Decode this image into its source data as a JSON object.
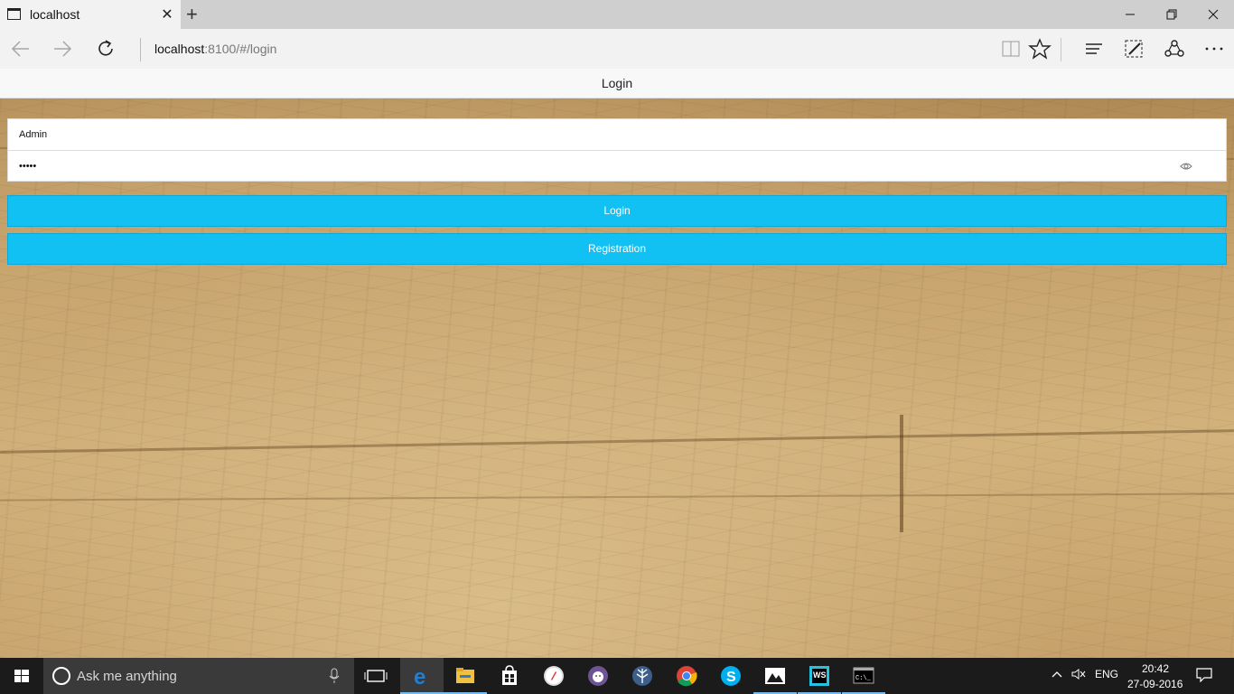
{
  "browser": {
    "tab_title": "localhost",
    "address_host": "localhost",
    "address_rest": ":8100/#/login"
  },
  "app": {
    "header_title": "Login",
    "username_value": "Admin",
    "password_value": "•••••",
    "login_button": "Login",
    "registration_button": "Registration"
  },
  "taskbar": {
    "search_placeholder": "Ask me anything",
    "language": "ENG",
    "time": "20:42",
    "date": "27-09-2016"
  },
  "colors": {
    "accent_button": "#11c1f3",
    "taskbar": "#1b1b1b",
    "edge_blue": "#1e7fd6"
  },
  "icons": [
    "tab-page-icon",
    "close-tab-icon",
    "new-tab-icon",
    "minimize-icon",
    "restore-icon",
    "close-window-icon",
    "back-icon",
    "forward-icon",
    "refresh-icon",
    "reading-view-icon",
    "favorite-star-icon",
    "hub-icon",
    "web-note-icon",
    "share-icon",
    "more-icon",
    "eye-icon",
    "windows-start-icon",
    "cortana-icon",
    "mic-icon",
    "task-view-icon",
    "edge-icon",
    "file-explorer-icon",
    "store-icon",
    "safari-icon",
    "github-icon",
    "app-tree-icon",
    "chrome-icon",
    "skype-icon",
    "photos-icon",
    "webstorm-icon",
    "terminal-icon",
    "chevron-up-icon",
    "volume-muted-icon",
    "notification-icon"
  ]
}
